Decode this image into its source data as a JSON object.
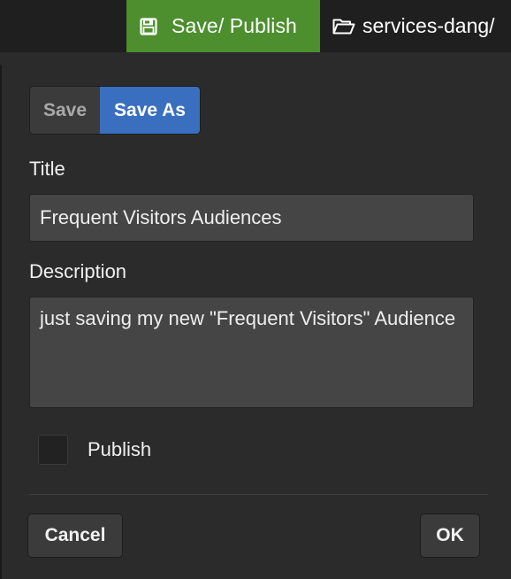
{
  "topbar": {
    "save_publish_label": "Save/ Publish",
    "save_publish_icon": "floppy-disk-icon",
    "save_publish_color": "#4d8f2e",
    "folder_label": "services-dang/",
    "folder_icon": "folder-open-icon"
  },
  "dialog": {
    "mode_options": {
      "save": "Save",
      "save_as": "Save As",
      "selected": "Save As"
    },
    "title_label": "Title",
    "title_value": "Frequent Visitors Audiences",
    "description_label": "Description",
    "description_value": "just saving my new \"Frequent Visitors\" Audience",
    "publish_label": "Publish",
    "publish_checked": false,
    "cancel_label": "Cancel",
    "ok_label": "OK",
    "accent_color": "#3a6fbf"
  }
}
